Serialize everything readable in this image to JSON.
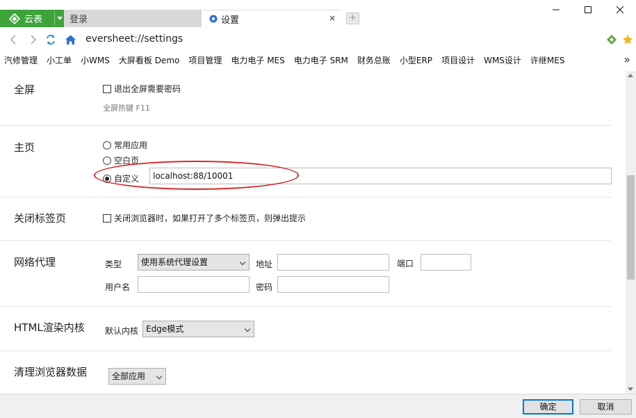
{
  "app": {
    "name": "云表"
  },
  "tabs": [
    {
      "label": "登录"
    },
    {
      "label": "设置"
    }
  ],
  "window": {
    "close_tab_glyph": "×",
    "new_tab_glyph": "+"
  },
  "address": {
    "url": "eversheet://settings"
  },
  "bookmarks": [
    "汽修管理",
    "小工单",
    "小WMS",
    "大屏看板 Demo",
    "项目管理",
    "电力电子 MES",
    "电力电子 SRM",
    "财务总账",
    "小型ERP",
    "项目设计",
    "WMS设计",
    "许继MES"
  ],
  "bookmarks_more": "»",
  "settings": {
    "fullscreen": {
      "title": "全屏",
      "checkbox_label": "退出全屏需要密码",
      "hint": "全屏热键 F11"
    },
    "homepage": {
      "title": "主页",
      "options": [
        "常用应用",
        "空白页",
        "自定义"
      ],
      "selected_index": 2,
      "custom_url": "localhost:88/10001"
    },
    "close_tabs": {
      "title": "关闭标签页",
      "checkbox_label": "关闭浏览器时，如果打开了多个标签页，则弹出提示"
    },
    "proxy": {
      "title": "网络代理",
      "type_label": "类型",
      "type_value": "使用系统代理设置",
      "address_label": "地址",
      "address_value": "",
      "port_label": "端口",
      "port_value": "",
      "username_label": "用户名",
      "username_value": "",
      "password_label": "密码",
      "password_value": ""
    },
    "render": {
      "title": "HTML渲染内核",
      "kernel_label": "默认内核",
      "kernel_value": "Edge模式"
    },
    "clear_data": {
      "title": "清理浏览器数据",
      "scope_value": "全部应用"
    }
  },
  "footer": {
    "ok_label": "确定",
    "cancel_label": "取消"
  },
  "colors": {
    "app_green": "#3da43a",
    "highlight_red": "#d42a2a",
    "focus_blue": "#0078d7"
  }
}
